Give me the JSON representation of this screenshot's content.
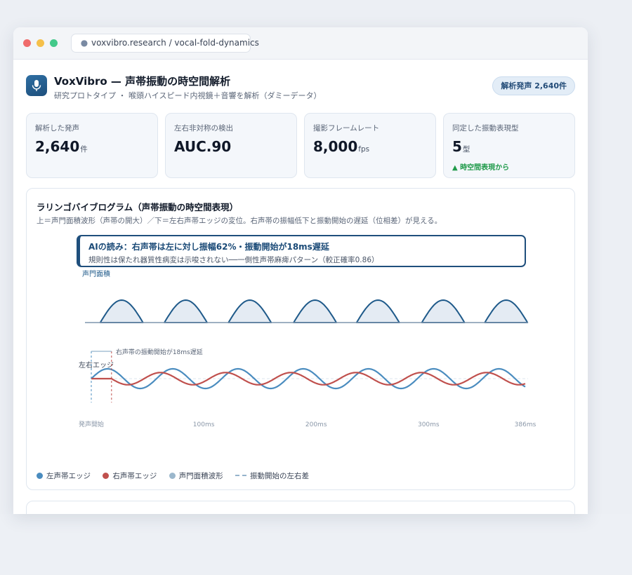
{
  "browser": {
    "url": "voxvibro.research / vocal-fold-dynamics"
  },
  "header": {
    "title": "VoxVibro — 声帯振動の時空間解析",
    "subtitle": "研究プロトタイプ ・ 喉頭ハイスピード内視鏡＋音響を解析（ダミーデータ）",
    "badge": "解析発声 2,640件"
  },
  "stats": [
    {
      "label": "解析した発声",
      "value": "2,640",
      "unit": "件"
    },
    {
      "label": "左右非対称の検出",
      "value": "AUC.90",
      "unit": ""
    },
    {
      "label": "撮影フレームレート",
      "value": "8,000",
      "unit": "fps"
    },
    {
      "label": "同定した振動表現型",
      "value": "5",
      "unit": "型",
      "trend": "▲ 時空間表現から"
    }
  ],
  "kymogram": {
    "title": "ラリンゴバイブログラム（声帯振動の時空間表現）",
    "subtitle": "上＝声門面積波形（声帯の開大）／下＝左右声帯エッジの変位。右声帯の振幅低下と振動開始の遅延（位相差）が見える。",
    "insight_title": "AIの読み：右声帯は左に対し振幅62%・振動開始が18ms遅延",
    "insight_body": "規則性は保たれ器質性病変は示唆されない──一側性声帯麻痺パターン（較正確率0.86）",
    "legend": [
      "左声帯エッジ",
      "右声帯エッジ",
      "声門面積波形",
      "振動開始の左右差"
    ]
  },
  "chart_data": {
    "type": "line",
    "x_unit": "ms",
    "xlim": [
      0,
      386
    ],
    "x_ticks": [
      {
        "value": 0,
        "label": "発声開始"
      },
      {
        "value": 100,
        "label": "100ms"
      },
      {
        "value": 200,
        "label": "200ms"
      },
      {
        "value": 300,
        "label": "300ms"
      },
      {
        "value": 386,
        "label": "386ms"
      }
    ],
    "top_panel_label": "声門面積",
    "bottom_panel_label": "左右エッジ",
    "onset_annotation": "右声帯の振動開始が18ms遅延",
    "glottal_pulses_start_ms": [
      8,
      65,
      122,
      180,
      236,
      294,
      350
    ],
    "glottal_pulse_width_ms": 38,
    "left_edge": {
      "onset_ms": 0,
      "period_ms": 58,
      "amplitude": 1.0
    },
    "right_edge": {
      "onset_ms": 18,
      "period_ms": 58,
      "amplitude": 0.62
    },
    "colors": {
      "left": "#4a8cbf",
      "right": "#c0504d",
      "glottal": "#1f5a8a",
      "glottal_fill": "#e4ebf3",
      "onset": "#95b3cc"
    }
  }
}
